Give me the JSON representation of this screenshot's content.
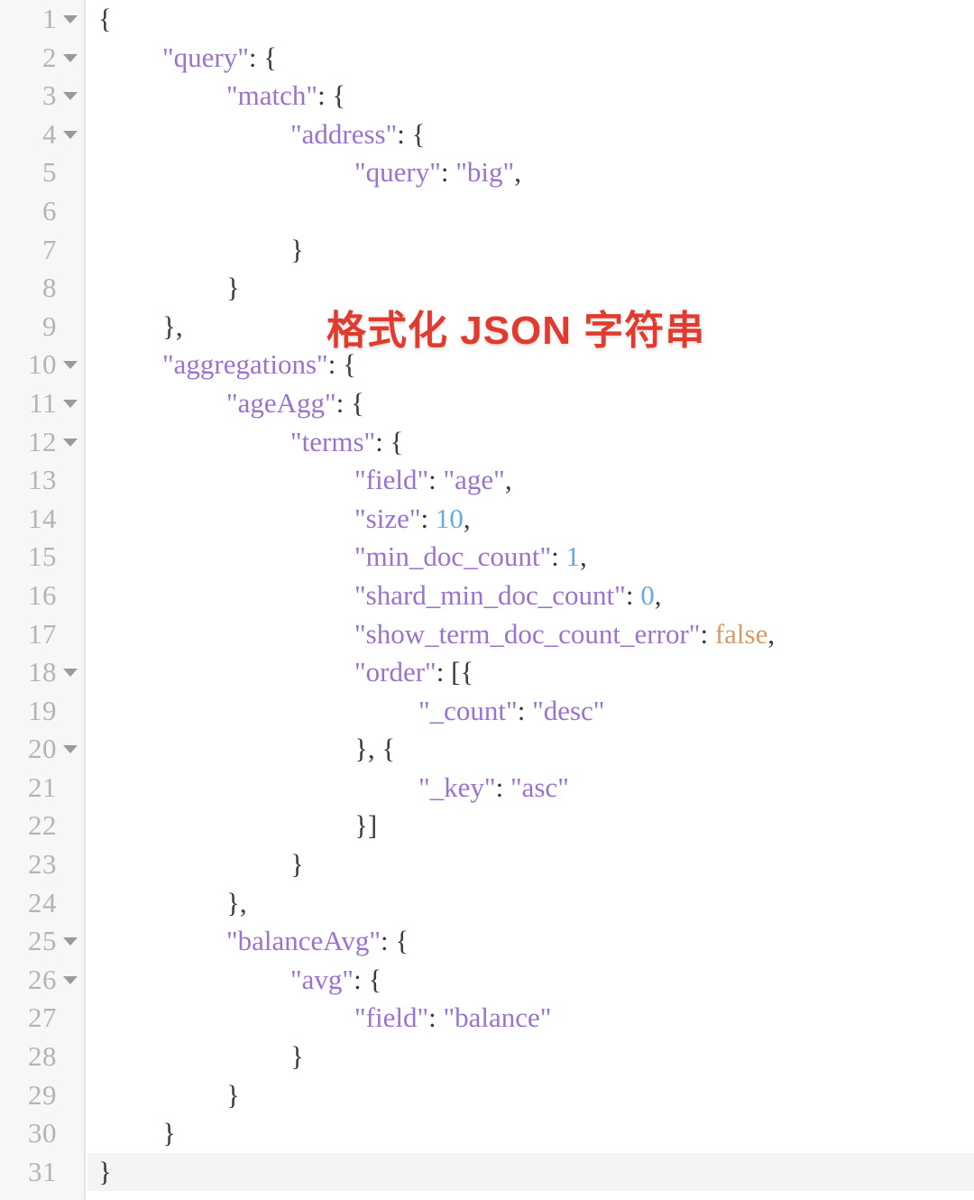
{
  "editor": {
    "language": "json",
    "total_lines": 31,
    "active_line": 31,
    "colors": {
      "background": "#ffffff",
      "gutter_background": "#f7f7f7",
      "gutter_border": "#e4e4e4",
      "line_number": "#b4b4b4",
      "fold_arrow": "#9a9a9a",
      "string": "#9b72cf",
      "number": "#6ba7e0",
      "boolean": "#d69a6b",
      "punctuation": "#3b3b3b",
      "active_line": "#f4f4f4"
    }
  },
  "overlay": {
    "caption": "格式化 JSON 字符串",
    "color": "#e03b2e",
    "stroke_color": "#ffffff"
  },
  "lines": [
    {
      "number": "1",
      "fold": true,
      "indent": 0,
      "tokens": [
        {
          "t": "punc",
          "v": "{"
        }
      ]
    },
    {
      "number": "2",
      "fold": true,
      "indent": 1,
      "tokens": [
        {
          "t": "key",
          "v": "\"query\""
        },
        {
          "t": "punc",
          "v": ": {"
        }
      ]
    },
    {
      "number": "3",
      "fold": true,
      "indent": 2,
      "tokens": [
        {
          "t": "key",
          "v": "\"match\""
        },
        {
          "t": "punc",
          "v": ": {"
        }
      ]
    },
    {
      "number": "4",
      "fold": true,
      "indent": 3,
      "tokens": [
        {
          "t": "key",
          "v": "\"address\""
        },
        {
          "t": "punc",
          "v": ": {"
        }
      ]
    },
    {
      "number": "5",
      "fold": false,
      "indent": 4,
      "tokens": [
        {
          "t": "key",
          "v": "\"query\""
        },
        {
          "t": "punc",
          "v": ": "
        },
        {
          "t": "str",
          "v": "\"big\""
        },
        {
          "t": "punc",
          "v": ","
        }
      ]
    },
    {
      "number": "6",
      "fold": false,
      "indent": 0,
      "tokens": []
    },
    {
      "number": "7",
      "fold": false,
      "indent": 3,
      "tokens": [
        {
          "t": "punc",
          "v": "}"
        }
      ]
    },
    {
      "number": "8",
      "fold": false,
      "indent": 2,
      "tokens": [
        {
          "t": "punc",
          "v": "}"
        }
      ]
    },
    {
      "number": "9",
      "fold": false,
      "indent": 1,
      "tokens": [
        {
          "t": "punc",
          "v": "},"
        }
      ]
    },
    {
      "number": "10",
      "fold": true,
      "indent": 1,
      "tokens": [
        {
          "t": "key",
          "v": "\"aggregations\""
        },
        {
          "t": "punc",
          "v": ": {"
        }
      ]
    },
    {
      "number": "11",
      "fold": true,
      "indent": 2,
      "tokens": [
        {
          "t": "key",
          "v": "\"ageAgg\""
        },
        {
          "t": "punc",
          "v": ": {"
        }
      ]
    },
    {
      "number": "12",
      "fold": true,
      "indent": 3,
      "tokens": [
        {
          "t": "key",
          "v": "\"terms\""
        },
        {
          "t": "punc",
          "v": ": {"
        }
      ]
    },
    {
      "number": "13",
      "fold": false,
      "indent": 4,
      "tokens": [
        {
          "t": "key",
          "v": "\"field\""
        },
        {
          "t": "punc",
          "v": ": "
        },
        {
          "t": "str",
          "v": "\"age\""
        },
        {
          "t": "punc",
          "v": ","
        }
      ]
    },
    {
      "number": "14",
      "fold": false,
      "indent": 4,
      "tokens": [
        {
          "t": "key",
          "v": "\"size\""
        },
        {
          "t": "punc",
          "v": ": "
        },
        {
          "t": "num",
          "v": "10"
        },
        {
          "t": "punc",
          "v": ","
        }
      ]
    },
    {
      "number": "15",
      "fold": false,
      "indent": 4,
      "tokens": [
        {
          "t": "key",
          "v": "\"min_doc_count\""
        },
        {
          "t": "punc",
          "v": ": "
        },
        {
          "t": "num",
          "v": "1"
        },
        {
          "t": "punc",
          "v": ","
        }
      ]
    },
    {
      "number": "16",
      "fold": false,
      "indent": 4,
      "tokens": [
        {
          "t": "key",
          "v": "\"shard_min_doc_count\""
        },
        {
          "t": "punc",
          "v": ": "
        },
        {
          "t": "num",
          "v": "0"
        },
        {
          "t": "punc",
          "v": ","
        }
      ]
    },
    {
      "number": "17",
      "fold": false,
      "indent": 4,
      "tokens": [
        {
          "t": "key",
          "v": "\"show_term_doc_count_error\""
        },
        {
          "t": "punc",
          "v": ": "
        },
        {
          "t": "bool",
          "v": "false"
        },
        {
          "t": "punc",
          "v": ","
        }
      ]
    },
    {
      "number": "18",
      "fold": true,
      "indent": 4,
      "tokens": [
        {
          "t": "key",
          "v": "\"order\""
        },
        {
          "t": "punc",
          "v": ": [{"
        }
      ]
    },
    {
      "number": "19",
      "fold": false,
      "indent": 5,
      "tokens": [
        {
          "t": "key",
          "v": "\"_count\""
        },
        {
          "t": "punc",
          "v": ": "
        },
        {
          "t": "str",
          "v": "\"desc\""
        }
      ]
    },
    {
      "number": "20",
      "fold": true,
      "indent": 4,
      "tokens": [
        {
          "t": "punc",
          "v": "}, {"
        }
      ]
    },
    {
      "number": "21",
      "fold": false,
      "indent": 5,
      "tokens": [
        {
          "t": "key",
          "v": "\"_key\""
        },
        {
          "t": "punc",
          "v": ": "
        },
        {
          "t": "str",
          "v": "\"asc\""
        }
      ]
    },
    {
      "number": "22",
      "fold": false,
      "indent": 4,
      "tokens": [
        {
          "t": "punc",
          "v": "}]"
        }
      ]
    },
    {
      "number": "23",
      "fold": false,
      "indent": 3,
      "tokens": [
        {
          "t": "punc",
          "v": "}"
        }
      ]
    },
    {
      "number": "24",
      "fold": false,
      "indent": 2,
      "tokens": [
        {
          "t": "punc",
          "v": "},"
        }
      ]
    },
    {
      "number": "25",
      "fold": true,
      "indent": 2,
      "tokens": [
        {
          "t": "key",
          "v": "\"balanceAvg\""
        },
        {
          "t": "punc",
          "v": ": {"
        }
      ]
    },
    {
      "number": "26",
      "fold": true,
      "indent": 3,
      "tokens": [
        {
          "t": "key",
          "v": "\"avg\""
        },
        {
          "t": "punc",
          "v": ": {"
        }
      ]
    },
    {
      "number": "27",
      "fold": false,
      "indent": 4,
      "tokens": [
        {
          "t": "key",
          "v": "\"field\""
        },
        {
          "t": "punc",
          "v": ": "
        },
        {
          "t": "str",
          "v": "\"balance\""
        }
      ]
    },
    {
      "number": "28",
      "fold": false,
      "indent": 3,
      "tokens": [
        {
          "t": "punc",
          "v": "}"
        }
      ]
    },
    {
      "number": "29",
      "fold": false,
      "indent": 2,
      "tokens": [
        {
          "t": "punc",
          "v": "}"
        }
      ]
    },
    {
      "number": "30",
      "fold": false,
      "indent": 1,
      "tokens": [
        {
          "t": "punc",
          "v": "}"
        }
      ]
    },
    {
      "number": "31",
      "fold": false,
      "indent": 0,
      "tokens": [
        {
          "t": "punc",
          "v": "}"
        }
      ]
    }
  ]
}
